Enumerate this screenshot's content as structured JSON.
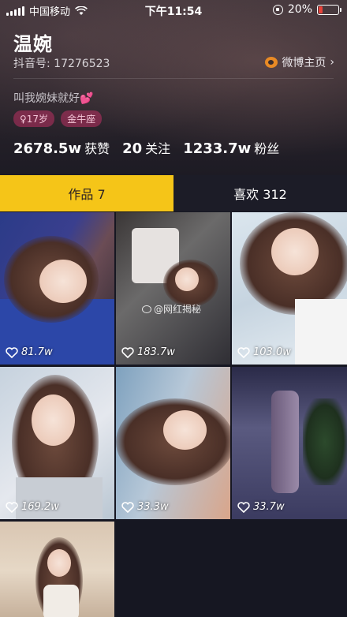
{
  "status_bar": {
    "carrier": "中国移动",
    "time": "下午11:54",
    "battery_text": "20%",
    "battery_level": 0.2
  },
  "profile": {
    "name": "温婉",
    "douyin_id": "抖音号: 17276523",
    "weibo_link": "微博主页",
    "bio": "叫我婉妹就好💕",
    "tags": [
      "♀17岁",
      "金牛座"
    ],
    "stats": [
      {
        "value": "2678.5w",
        "label": "获赞"
      },
      {
        "value": "20",
        "label": "关注"
      },
      {
        "value": "1233.7w",
        "label": "粉丝"
      }
    ]
  },
  "tabs": [
    {
      "label": "作品 7",
      "active": true
    },
    {
      "label": "喜欢 312",
      "active": false
    }
  ],
  "videos": [
    {
      "likes": "81.7w"
    },
    {
      "likes": "183.7w"
    },
    {
      "likes": "103.0w"
    },
    {
      "likes": "169.2w"
    },
    {
      "likes": "33.3w"
    },
    {
      "likes": "33.7w"
    },
    {
      "likes": ""
    }
  ],
  "watermark": "@网红揭秘",
  "colors": {
    "accent": "#f5c518",
    "background": "#161722",
    "tag_bg": "#dc326e",
    "battery_low": "#e8433a"
  }
}
